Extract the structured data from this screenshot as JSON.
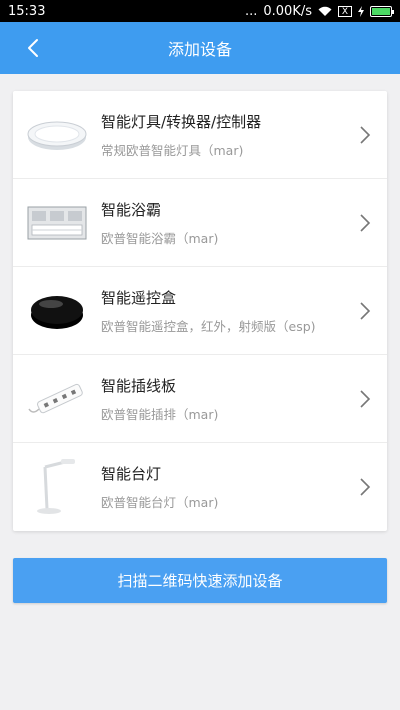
{
  "status_bar": {
    "time": "15:33",
    "dots": "...",
    "network_speed": "0.00K/s",
    "sim_label": "X"
  },
  "header": {
    "title": "添加设备"
  },
  "devices": [
    {
      "name": "智能灯具/转换器/控制器",
      "desc": "常规欧普智能灯具（mar)",
      "icon": "ceiling-light"
    },
    {
      "name": "智能浴霸",
      "desc": "欧普智能浴霸（mar)",
      "icon": "bath-heater"
    },
    {
      "name": "智能遥控盒",
      "desc": "欧普智能遥控盒，红外，射频版（esp)",
      "icon": "remote-box"
    },
    {
      "name": "智能插线板",
      "desc": "欧普智能插排（mar)",
      "icon": "power-strip"
    },
    {
      "name": "智能台灯",
      "desc": "欧普智能台灯（mar)",
      "icon": "desk-lamp"
    }
  ],
  "scan_button": {
    "label": "扫描二维码快速添加设备"
  },
  "colors": {
    "primary": "#3e9cf0",
    "button": "#4aa0f2",
    "background": "#f0f0f2"
  }
}
